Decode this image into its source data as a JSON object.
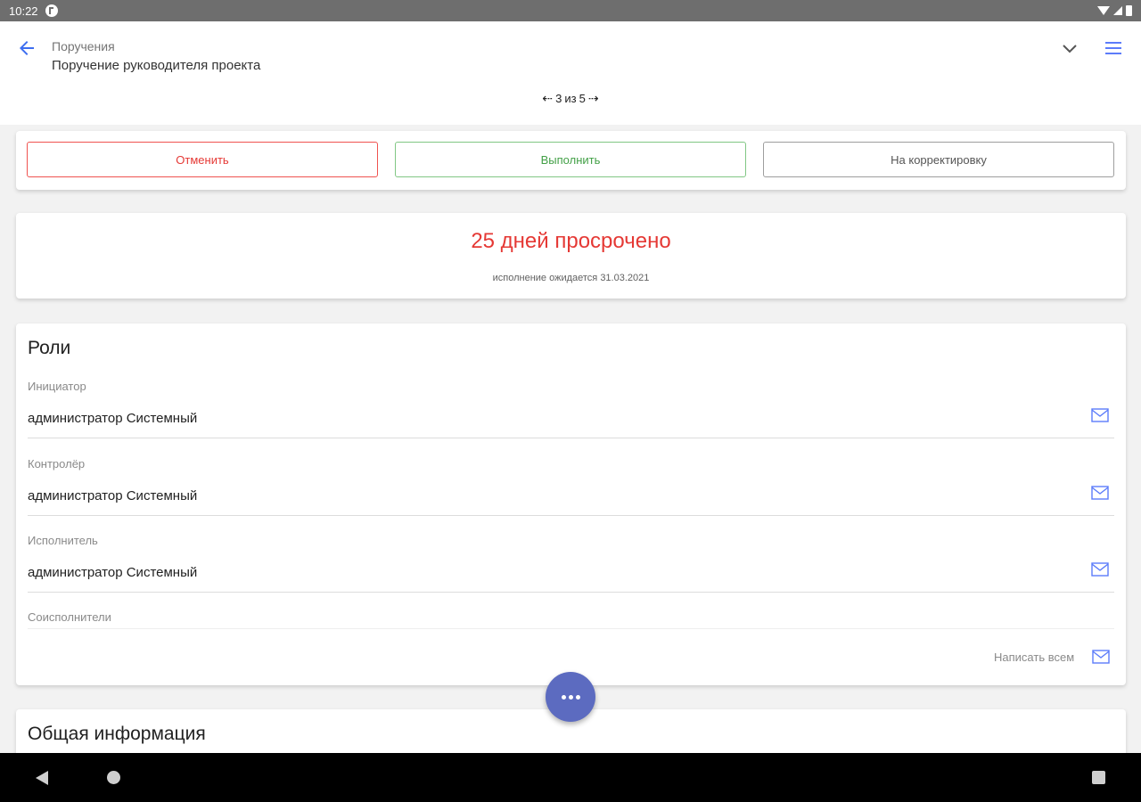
{
  "statusbar": {
    "time": "10:22"
  },
  "header": {
    "parent": "Поручения",
    "title": "Поручение руководителя проекта",
    "pager": {
      "current": "3",
      "of_label": "из",
      "total": "5"
    }
  },
  "actions": {
    "cancel": "Отменить",
    "complete": "Выполнить",
    "correction": "На корректировку"
  },
  "overdue": {
    "headline": "25 дней просрочено",
    "expected": "исполнение ожидается 31.03.2021"
  },
  "roles": {
    "title": "Роли",
    "items": [
      {
        "label": "Инициатор",
        "value": "администратор Системный"
      },
      {
        "label": "Контролёр",
        "value": "администратор Системный"
      },
      {
        "label": "Исполнитель",
        "value": "администратор Системный"
      },
      {
        "label": "Соисполнители",
        "value": ""
      }
    ],
    "write_all": "Написать всем"
  },
  "general": {
    "title": "Общая информация"
  },
  "colors": {
    "accent": "#5c6bc0",
    "danger": "#e53935",
    "success": "#43a047",
    "icon_blue": "#5c7cfa"
  }
}
